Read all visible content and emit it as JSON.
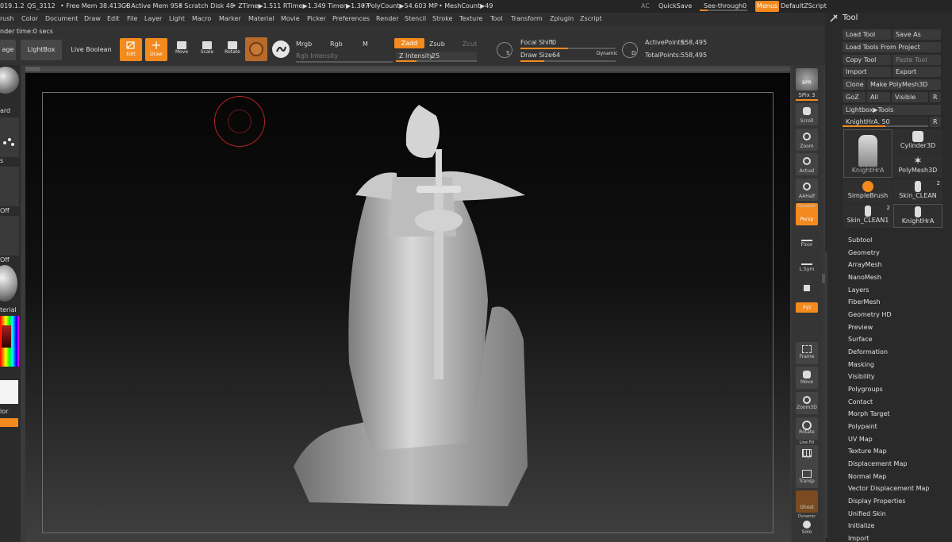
{
  "status": {
    "items": [
      "019.1.2",
      "QS_3112",
      "• Free Mem 38.413GB",
      "• Active Mem 958",
      "• Scratch Disk 48",
      "• ZTime▶1.511 RTime▶1.349 Timer▶1.307",
      "• PolyCount▶54.603 MP",
      "• MeshCount▶49"
    ],
    "right": {
      "ac": "AC",
      "quicksave": "QuickSave",
      "seethrough_label": "See-through",
      "seethrough_value": "0",
      "menus": "Menus",
      "script": "DefaultZScript"
    }
  },
  "menubar": [
    "rush",
    "Color",
    "Document",
    "Draw",
    "Edit",
    "File",
    "Layer",
    "Light",
    "Macro",
    "Marker",
    "Material",
    "Movie",
    "Picker",
    "Preferences",
    "Render",
    "Stencil",
    "Stroke",
    "Texture",
    "Tool",
    "Transform",
    "Zplugin",
    "Zscript"
  ],
  "toolbar": {
    "render_time": "nder time:0 secs",
    "age": "age",
    "lightbox": "LightBox",
    "live_boolean": "Live Boolean",
    "edit": "Edit",
    "draw": "Draw",
    "move": "Move",
    "scale": "Scale",
    "rotate": "Rotate",
    "mrgb": "Mrgb",
    "rgb": "Rgb",
    "m": "M",
    "rgb_intensity": "Rgb Intensity",
    "zadd": "Zadd",
    "zsub": "Zsub",
    "zcut": "Zcut",
    "z_intensity_label": "Z Intensity",
    "z_intensity_value": "25",
    "focal_shift_label": "Focal Shift",
    "focal_shift_value": "0",
    "draw_size_label": "Draw Size",
    "draw_size_value": "64",
    "dynamic": "Dynamic",
    "s_icon_letter": "S",
    "d_icon_letter": "D",
    "active_points_label": "ActivePoints:",
    "active_points_value": "558,495",
    "total_points_label": "TotalPoints:",
    "total_points_value": "558,495",
    "z_intensity_level": 0.25,
    "focal_shift_level": 0.5,
    "draw_size_level": 0.25
  },
  "left_shelf": [
    "ard",
    "s",
    "Off",
    "Off",
    "terial",
    "lor"
  ],
  "right_shelf": {
    "bpr": "BPR",
    "spix": "SPix 3",
    "scroll": "Scroll",
    "zoom": "Zoom",
    "actual": "Actual",
    "aahalf": "AAHalf",
    "dynamic": "Dynamic",
    "persp": "Persp",
    "floor": "Floor",
    "lsym": "L.Sym",
    "xyz": "Xyz",
    "frame": "Frame",
    "move": "Move",
    "zoom3d": "Zoom3D",
    "rotate": "Rotate",
    "linefill": "Line Fill",
    "polyf": "PolyF",
    "transp": "Transp",
    "ghost": "Ghost",
    "dynamic2": "Dynamic",
    "solo": "Solo"
  },
  "tool_palette": {
    "title": "Tool",
    "load_tool": "Load Tool",
    "save_as": "Save As",
    "load_from_project": "Load Tools From Project",
    "copy_tool": "Copy Tool",
    "paste_tool": "Paste Tool",
    "import": "Import",
    "export": "Export",
    "clone": "Clone",
    "make_polymesh": "Make PolyMesh3D",
    "goz": "GoZ",
    "all": "All",
    "visible": "Visible",
    "r": "R",
    "lightbox_tools": "Lightbox▶Tools",
    "current_tool": "KnightHrA. 50",
    "current_tool_level": 0.5,
    "tools": [
      {
        "name": "KnightHrA",
        "count": ""
      },
      {
        "name": "Cylinder3D",
        "count": ""
      },
      {
        "name": "PolyMesh3D",
        "count": ""
      },
      {
        "name": "SimpleBrush",
        "count": ""
      },
      {
        "name": "Skin_CLEAN",
        "count": "2"
      },
      {
        "name": "Skin_CLEAN1",
        "count": "2"
      },
      {
        "name": "KnightHrA",
        "count": ""
      }
    ],
    "subpalettes": [
      "Subtool",
      "Geometry",
      "ArrayMesh",
      "NanoMesh",
      "Layers",
      "FiberMesh",
      "Geometry HD",
      "Preview",
      "Surface",
      "Deformation",
      "Masking",
      "Visibility",
      "Polygroups",
      "Contact",
      "Morph Target",
      "Polypaint",
      "UV Map",
      "Texture Map",
      "Displacement Map",
      "Normal Map",
      "Vector Displacement Map",
      "Display Properties",
      "Unified Skin",
      "Initialize",
      "Import"
    ]
  }
}
